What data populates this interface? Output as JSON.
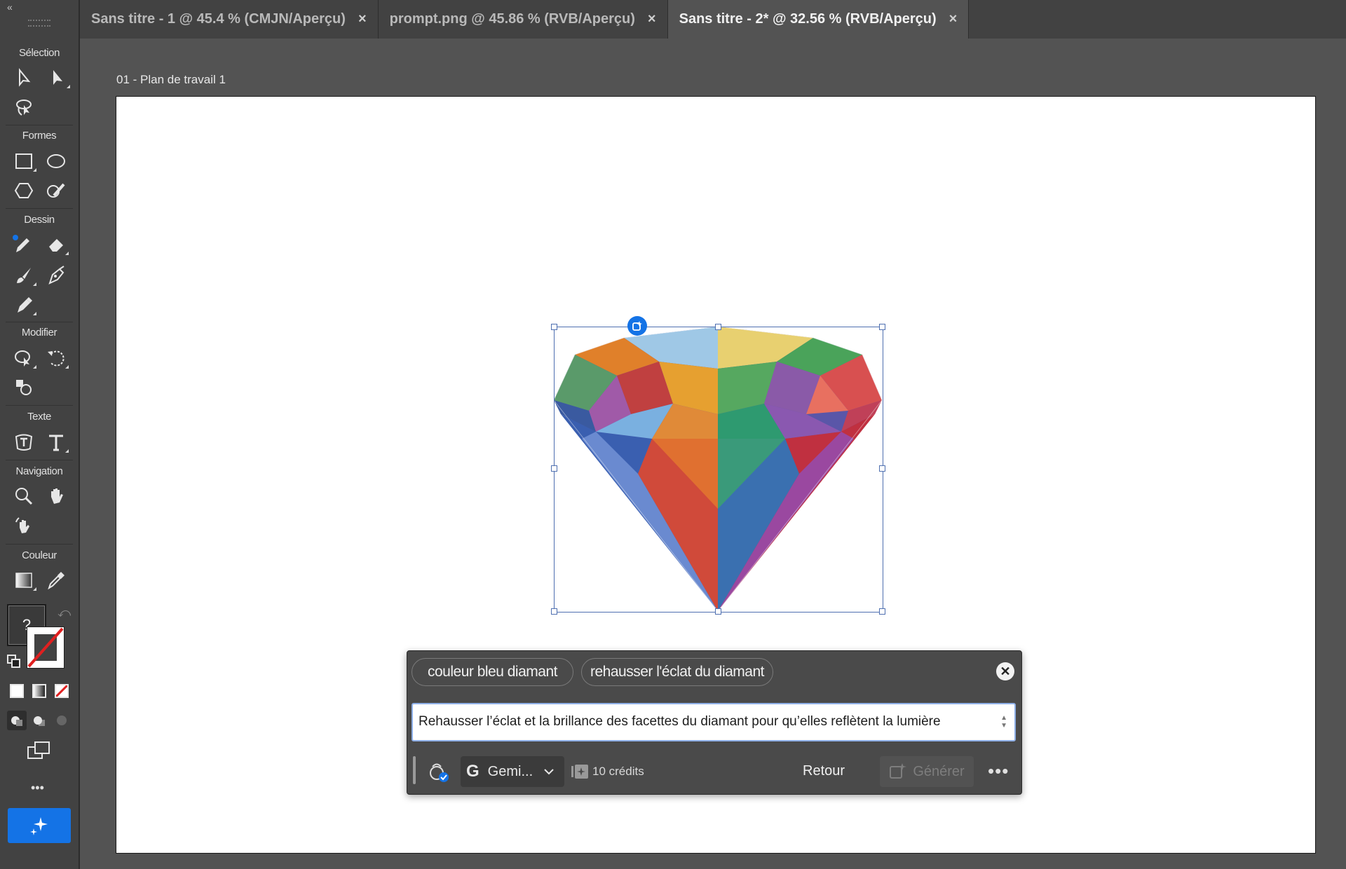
{
  "tabs": [
    {
      "title": "Sans titre - 1 @ 45.4 % (CMJN/Aperçu)",
      "close": "×",
      "active": false
    },
    {
      "title": "prompt.png @ 45.86 % (RVB/Aperçu)",
      "close": "×",
      "active": false
    },
    {
      "title": "Sans titre - 2* @ 32.56 % (RVB/Aperçu)",
      "close": "×",
      "active": true
    }
  ],
  "toolbar": {
    "collapse": "«",
    "sections": {
      "selection": "Sélection",
      "shapes": "Formes",
      "drawing": "Dessin",
      "modify": "Modifier",
      "text": "Texte",
      "navigation": "Navigation",
      "color": "Couleur"
    },
    "fill_unknown": "?",
    "more": "•••"
  },
  "artboard": {
    "label": "01 - Plan de travail 1"
  },
  "prompt_panel": {
    "suggestions": [
      "couleur bleu diamant",
      "rehausser l'éclat du diamant"
    ],
    "prompt_text": "Rehausser l’éclat et la brillance des facettes du diamant pour qu’elles reflètent la lumière",
    "model_label": "Gemi...",
    "credits": "10 crédits",
    "back_label": "Retour",
    "generate_label": "Générer",
    "more": "•••",
    "close": "✕"
  },
  "colors": {
    "accent": "#1473e6",
    "ui_dark": "#424242",
    "canvas_bg": "#535353"
  }
}
